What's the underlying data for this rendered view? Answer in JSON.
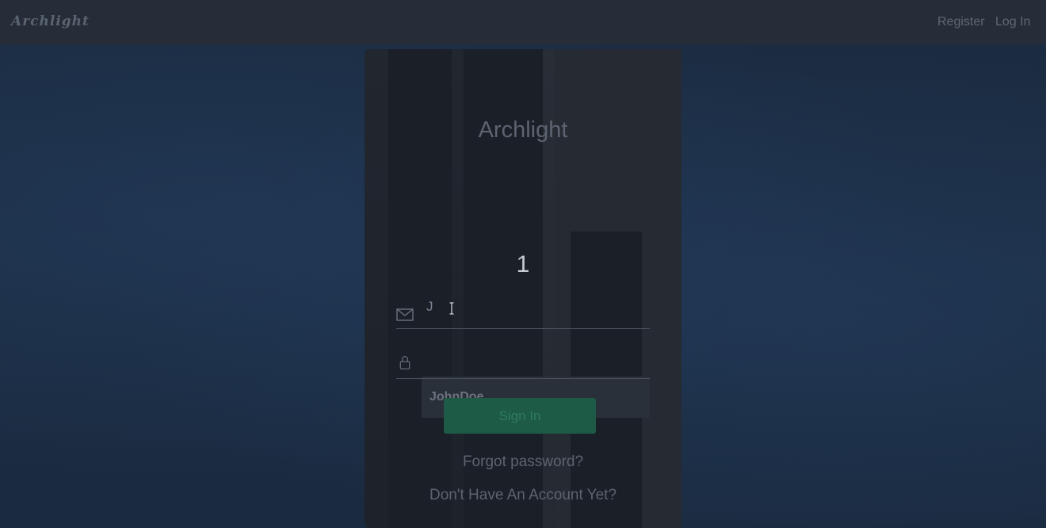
{
  "navbar": {
    "brand": "Archlight",
    "links": [
      "Register",
      "Log In"
    ]
  },
  "card": {
    "title": "Archlight",
    "counter": "1",
    "email_field": {
      "value": "J",
      "icon": "envelope-icon"
    },
    "password_field": {
      "value": "",
      "icon": "lock-icon"
    },
    "autocomplete_suggestion": "JohnDoe",
    "sign_in_label": "Sign In",
    "forgot_password": "Forgot password?",
    "no_account": "Don't Have An Account Yet?"
  },
  "colors": {
    "navbar_bg": "#262d38",
    "page_bg": "#1c2e45",
    "button_bg": "#1d5b46"
  }
}
